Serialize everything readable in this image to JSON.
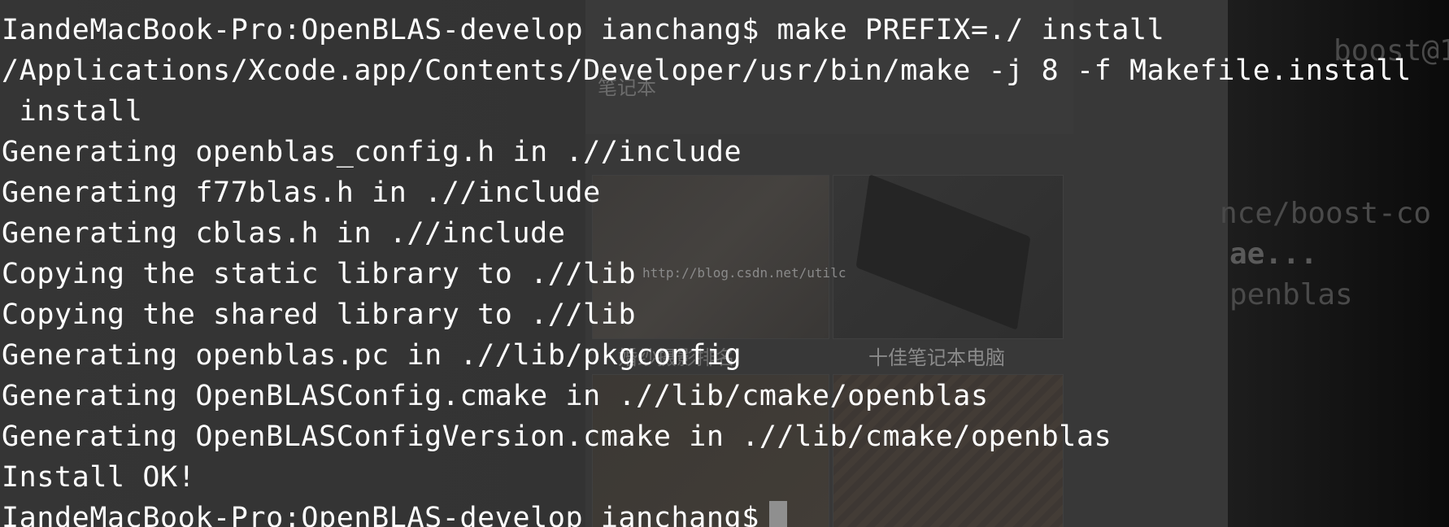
{
  "terminal": {
    "lines": [
      "IandeMacBook-Pro:OpenBLAS-develop ianchang$ make PREFIX=./ install",
      "/Applications/Xcode.app/Contents/Developer/usr/bin/make -j 8 -f Makefile.install",
      " install",
      "Generating openblas_config.h in .//include",
      "Generating f77blas.h in .//include",
      "Generating cblas.h in .//include",
      "Copying the static library to .//lib",
      "Copying the shared library to .//lib",
      "Generating openblas.pc in .//lib/pkgconfig",
      "Generating OpenBLASConfig.cmake in .//lib/cmake/openblas",
      "Generating OpenBLASConfigVersion.cmake in .//lib/cmake/openblas",
      "Install OK!"
    ],
    "prompt": "IandeMacBook-Pro:OpenBLAS-develop ianchang$"
  },
  "background": {
    "watermark": "http://blog.csdn.net/utilc",
    "captions": [
      "十佳笔记本电脑",
      "婚纱摄影排名",
      "笔记本"
    ],
    "right_text": [
      "boost@1",
      "nce/boost-co",
      "ae...",
      "penblas"
    ]
  },
  "colors": {
    "terminal_text": "#ffffff",
    "cursor": "#8f8f8f"
  }
}
